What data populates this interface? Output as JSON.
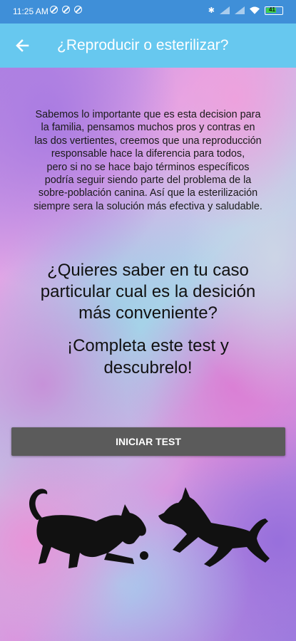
{
  "status_bar": {
    "time": "11:25 AM",
    "left_icons": [
      "blocked-circle-icon",
      "blocked-circle-icon",
      "blocked-circle-icon"
    ],
    "right_icons": [
      "bluetooth-icon",
      "signal-icon",
      "signal-icon",
      "wifi-icon",
      "battery-icon"
    ],
    "battery_level": "41",
    "color": "#3f8fd8"
  },
  "app_bar": {
    "title": "¿Reproducir o esterilizar?",
    "back_icon": "arrow-left-icon",
    "color": "#67c8ef"
  },
  "content": {
    "intro_lines": [
      "Sabemos lo importante que es esta decision para",
      "la familia, pensamos muchos pros y contras en",
      "las dos vertientes, creemos que una reproducción",
      "responsable hace la diferencia para todos,",
      "pero si no se hace bajo términos específicos",
      "podría seguir siendo parte del problema de la",
      "sobre-población canina. Así que la esterilización",
      "siempre sera la solución más efectiva y saludable."
    ],
    "question_lines": [
      "¿Quieres saber en tu caso",
      "particular cual es la desición",
      "más conveniente?"
    ],
    "cta_lines": [
      "¡Completa este test y",
      "descubrelo!"
    ],
    "start_button_label": "INICIAR TEST",
    "start_button_color": "#5b5b5b",
    "illustration": "two-dogs-playing-silhouette"
  }
}
